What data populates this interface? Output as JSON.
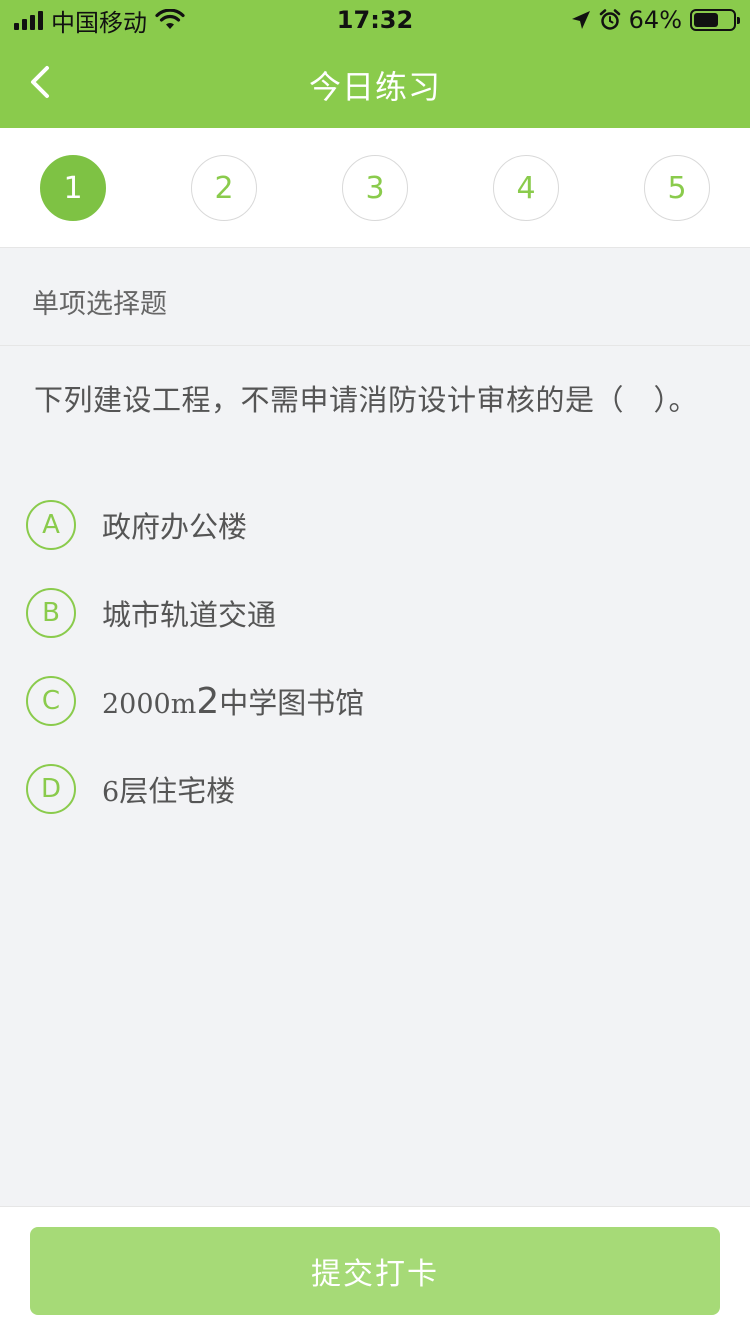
{
  "status_bar": {
    "carrier": "中国移动",
    "time": "17:32",
    "battery_percent": "64%",
    "battery_level": 0.64
  },
  "nav": {
    "title": "今日练习",
    "back_icon": "chevron-left-icon"
  },
  "steps": [
    {
      "label": "1",
      "active": true
    },
    {
      "label": "2",
      "active": false
    },
    {
      "label": "3",
      "active": false
    },
    {
      "label": "4",
      "active": false
    },
    {
      "label": "5",
      "active": false
    }
  ],
  "question": {
    "type": "单项选择题",
    "text": "下列建设工程，不需申请消防设计审核的是（　）。",
    "options": [
      {
        "letter": "A",
        "text": "政府办公楼"
      },
      {
        "letter": "B",
        "text": "城市轨道交通"
      },
      {
        "letter": "C",
        "text_prefix": "2000m",
        "text_sup": "2",
        "text_suffix": "中学图书馆"
      },
      {
        "letter": "D",
        "text_prefix": "6",
        "text_suffix": "层住宅楼"
      }
    ]
  },
  "footer": {
    "submit_label": "提交打卡"
  },
  "colors": {
    "brand_green": "#8acb4c",
    "submit_green": "#a6da77",
    "background": "#f2f3f5"
  }
}
